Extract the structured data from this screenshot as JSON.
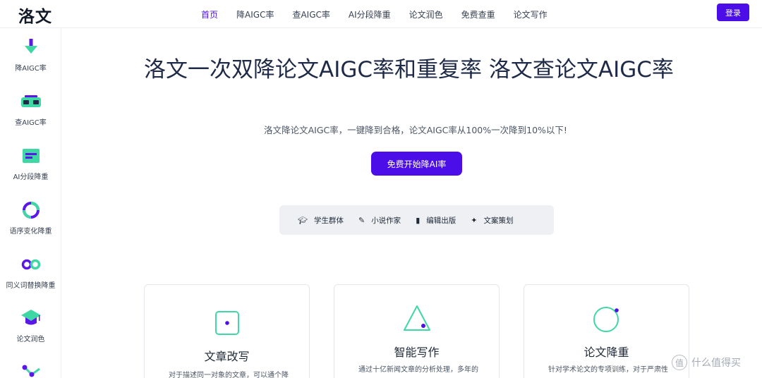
{
  "brand": {
    "logo": "洛文"
  },
  "nav": {
    "items": [
      "首页",
      "降AIGC率",
      "查AIGC率",
      "AI分段降重",
      "论文润色",
      "免费查重",
      "论文写作"
    ],
    "active_index": 0
  },
  "header": {
    "login_label": "登录"
  },
  "sidebar": {
    "items": [
      {
        "label": "降AIGC率",
        "icon": "down-arrow-icon"
      },
      {
        "label": "查AIGC率",
        "icon": "vr-glasses-icon"
      },
      {
        "label": "AI分段降重",
        "icon": "text-block-icon"
      },
      {
        "label": "语序变化降重",
        "icon": "refresh-icon"
      },
      {
        "label": "同义词替换降重",
        "icon": "infinity-icon"
      },
      {
        "label": "论文润色",
        "icon": "graduation-cap-icon"
      }
    ]
  },
  "hero": {
    "title": "洛文一次双降论文AIGC率和重复率 洛文查论文AIGC率",
    "subtitle": "洛文降论文AIGC率，一键降到合格，论文AIGC率从100%一次降到10%以下!",
    "cta_label": "免费开始降AI率"
  },
  "audience": {
    "items": [
      {
        "label": "学生群体",
        "icon": "graduation-cap-icon"
      },
      {
        "label": "小说作家",
        "icon": "feather-pen-icon"
      },
      {
        "label": "编辑出版",
        "icon": "book-icon"
      },
      {
        "label": "文案策划",
        "icon": "sparkle-icon"
      }
    ]
  },
  "cards": [
    {
      "title": "文章改写",
      "desc": "对于描述同一对象的文章，可以通个降",
      "icon": "dice-square-icon"
    },
    {
      "title": "智能写作",
      "desc": "通过十亿新闻文章的分析处理，多年的",
      "icon": "triangle-icon"
    },
    {
      "title": "论文降重",
      "desc": "针对学术论文的专项训练，对于严肃性",
      "icon": "circle-icon"
    }
  ],
  "watermark": {
    "text": "什么值得买",
    "icon": "值"
  },
  "colors": {
    "primary": "#4b0ee8",
    "accent_teal": "#3fd7a4",
    "accent_purple": "#5b17e8"
  }
}
